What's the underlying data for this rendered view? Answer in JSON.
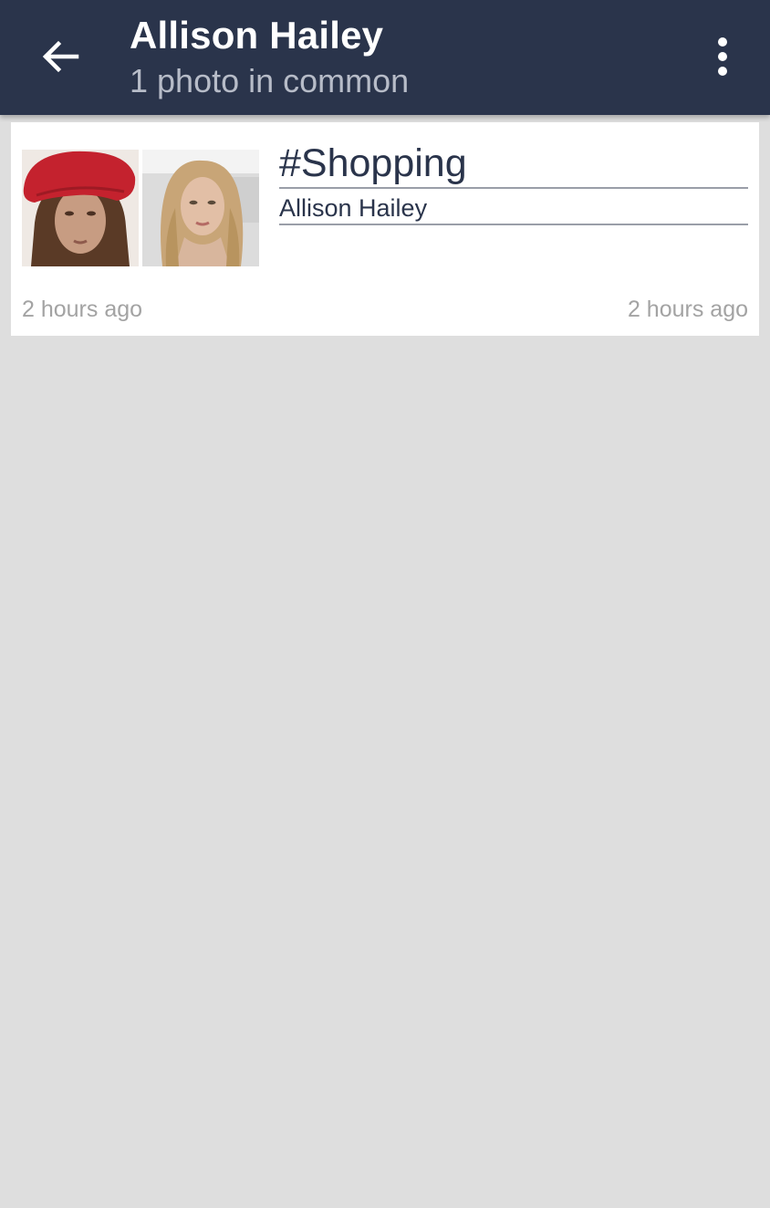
{
  "header": {
    "title": "Allison Hailey",
    "subtitle": "1 photo in common",
    "back_icon": "arrow-left-icon",
    "menu_icon": "more-vertical-icon"
  },
  "card": {
    "tag": "#Shopping",
    "owner": "Allison Hailey",
    "time_left": "2 hours ago",
    "time_right": "2 hours ago",
    "thumbnails": [
      "woman-red-beret-photo",
      "woman-long-blonde-hair-photo"
    ]
  },
  "colors": {
    "app_bar": "#2a344b",
    "background": "#dedede",
    "card": "#ffffff",
    "accent_text": "#2a344b",
    "muted_text": "#a3a3a3"
  }
}
